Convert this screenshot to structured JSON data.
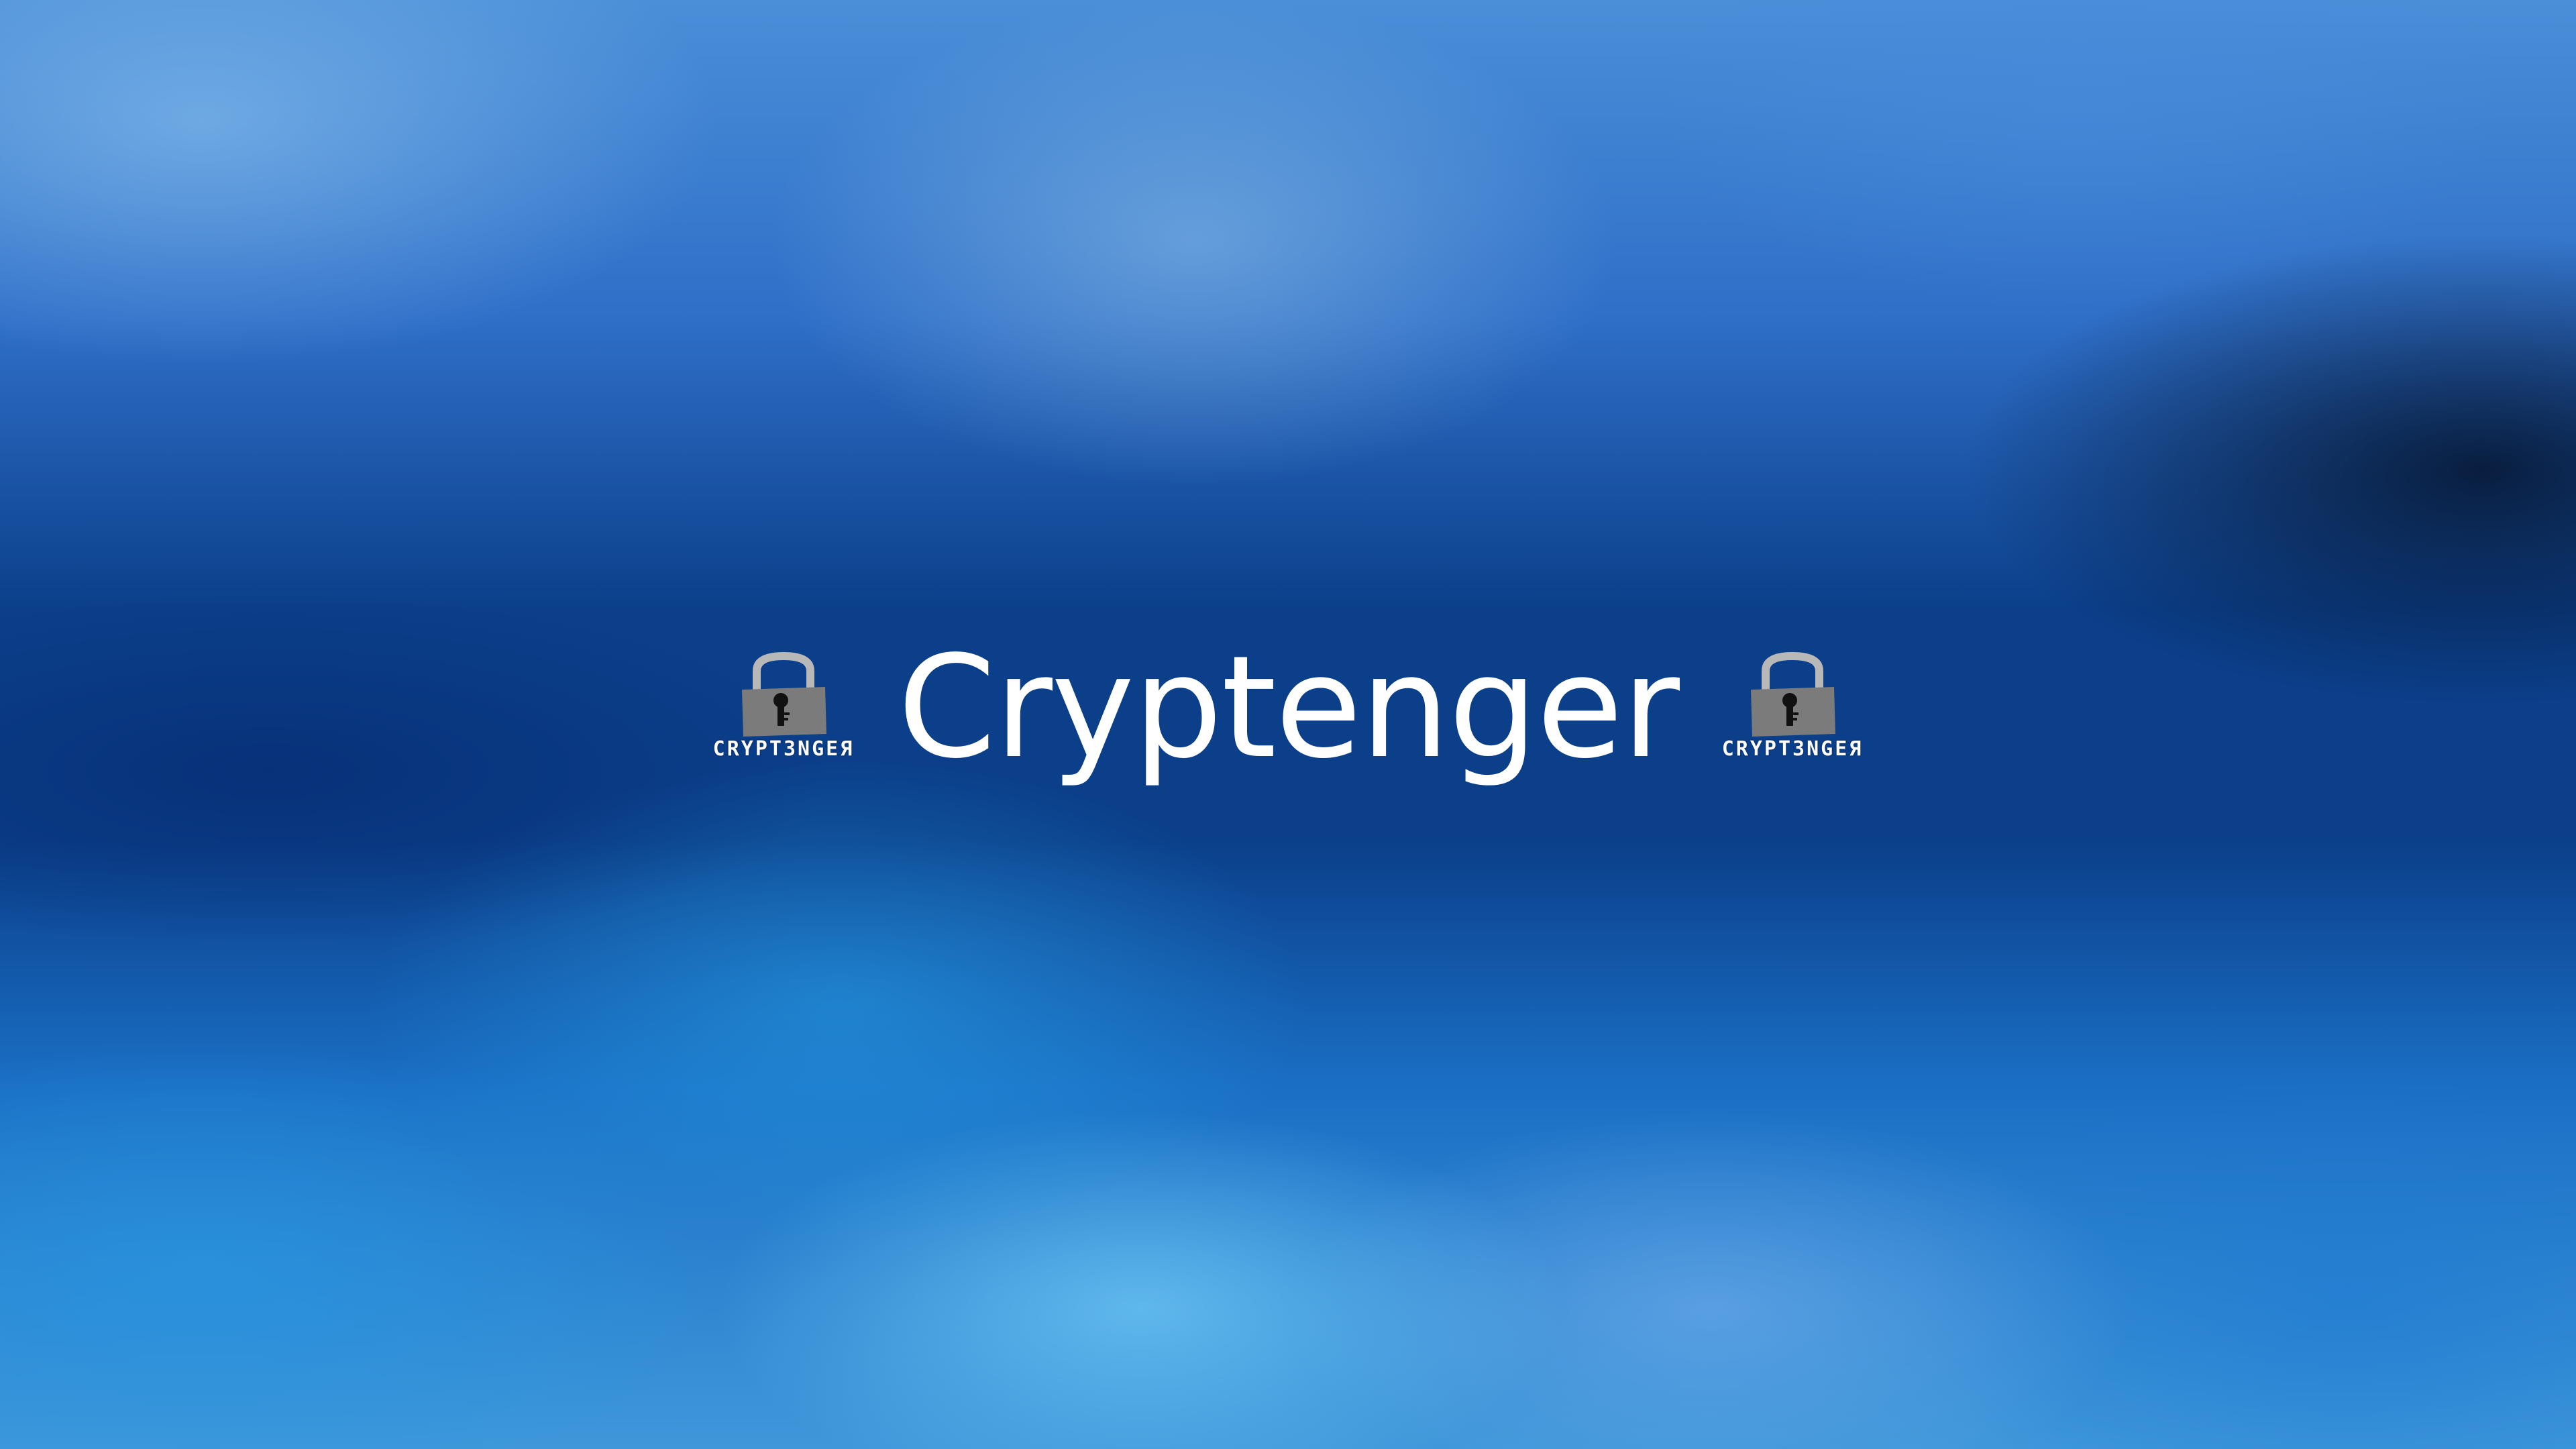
{
  "app": {
    "title": "Cryptenger"
  },
  "logo": {
    "caption": "CRYPT3NGEЯ",
    "icon": "padlock-icon"
  },
  "colors": {
    "background_primary": "#0b3f8a",
    "background_light": "#4a8fd8",
    "title_text": "#ffffff",
    "lock_body": "#7b7b7b",
    "lock_shackle": "#b8b8b8",
    "keyhole": "#111111"
  }
}
